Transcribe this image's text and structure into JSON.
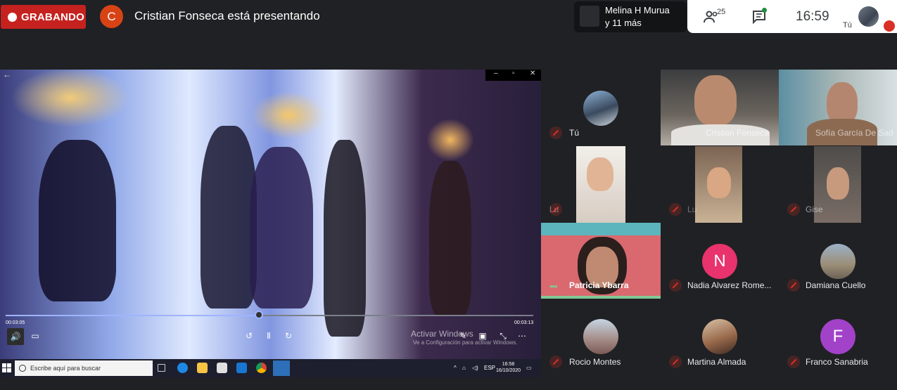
{
  "topbar": {
    "recording_label": "GRABANDO",
    "presenter_initial": "C",
    "presenter_text": "Cristian Fonseca está presentando",
    "speaker_name": "Melina H Murua",
    "speaker_more": "y 11 más",
    "participants_count": "25",
    "clock": "16:59",
    "self_label": "Tú"
  },
  "player": {
    "time_current": "00:03:05",
    "time_total": "00:03:13",
    "progress": 0.48,
    "watermark_title": "Activar Windows",
    "watermark_sub": "Ve a Configuración para activar Windows."
  },
  "taskbar": {
    "search_placeholder": "Escribe aquí para buscar",
    "lang": "ESP",
    "time": "16:58",
    "date": "16/10/2020"
  },
  "participants": [
    {
      "name": "Tú"
    },
    {
      "name": "Cristian Fonseca"
    },
    {
      "name": "Sofía García De Sad"
    },
    {
      "name": "Lu"
    },
    {
      "name": "Lu"
    },
    {
      "name": "Gise"
    },
    {
      "name": "Patricia Ybarra"
    },
    {
      "name": "Nadia Alvarez Rome...",
      "initial": "N"
    },
    {
      "name": "Damiana Cuello"
    },
    {
      "name": "Rocio Montes"
    },
    {
      "name": "Martina Almada"
    },
    {
      "name": "Franco Sanabria",
      "initial": "F"
    }
  ],
  "colors": {
    "recording": "#c5221f",
    "avatar_n": "#e8336d",
    "avatar_f": "#a142c9",
    "active_speaker": "#81c995"
  }
}
